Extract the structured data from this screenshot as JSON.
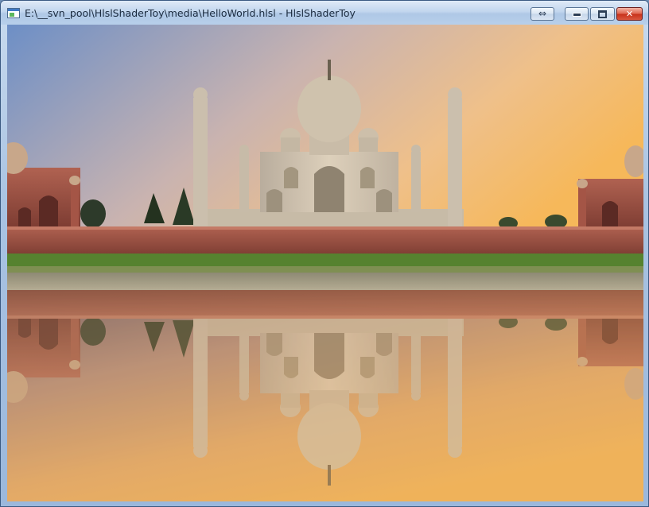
{
  "window": {
    "title": "E:\\__svn_pool\\HlslShaderToy\\media\\HelloWorld.hlsl - HlslShaderToy",
    "buttons": {
      "resize_glyph": "⇔",
      "close_glyph": "✕"
    }
  },
  "icons": {
    "app": "app-window-icon",
    "resize": "double-arrow-icon",
    "minimize": "minimize-icon",
    "maximize": "maximize-icon",
    "close": "close-icon"
  },
  "colors": {
    "sky_top": "#6f8fc4",
    "sky_mid": "#d9b49a",
    "sky_bottom": "#f5c46e",
    "marble": "#d6c8b2",
    "red_sandstone": "#9a4b3b",
    "grass": "#4f7a2e",
    "water_top": "#5d4c5c",
    "water_bottom": "#f0b25e"
  }
}
